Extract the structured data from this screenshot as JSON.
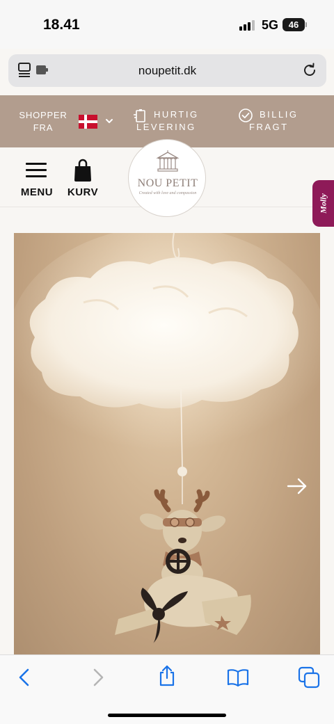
{
  "status_bar": {
    "time": "18.41",
    "network": "5G",
    "battery": "46"
  },
  "browser": {
    "url": "noupetit.dk"
  },
  "promo": {
    "shopper_from": "SHOPPER FRA",
    "flag": "denmark-flag",
    "fast_delivery": [
      "HURTIG",
      "LEVERING"
    ],
    "cheap_shipping": [
      "BILLIG",
      "FRAGT"
    ]
  },
  "header": {
    "menu_label": "MENU",
    "cart_label": "KURV",
    "logo_name": "NOU PETIT",
    "logo_tagline": "Created with love and compassion"
  },
  "chat_widget": {
    "label": "Molly",
    "color": "#8e1a58"
  },
  "colors": {
    "promo_bar": "#b29d8e",
    "browser_accent": "#1a73e8"
  },
  "icons": {
    "tabs": "tabs-icon",
    "reload": "reload-icon",
    "delivery": "delivery-icon",
    "check": "check-circle-icon",
    "menu": "hamburger-icon",
    "cart": "bag-icon",
    "next": "arrow-right-icon",
    "back": "chevron-left-icon",
    "forward": "chevron-right-icon",
    "share": "share-icon",
    "bookmarks": "book-icon",
    "tabs_overview": "tabs-overview-icon"
  }
}
